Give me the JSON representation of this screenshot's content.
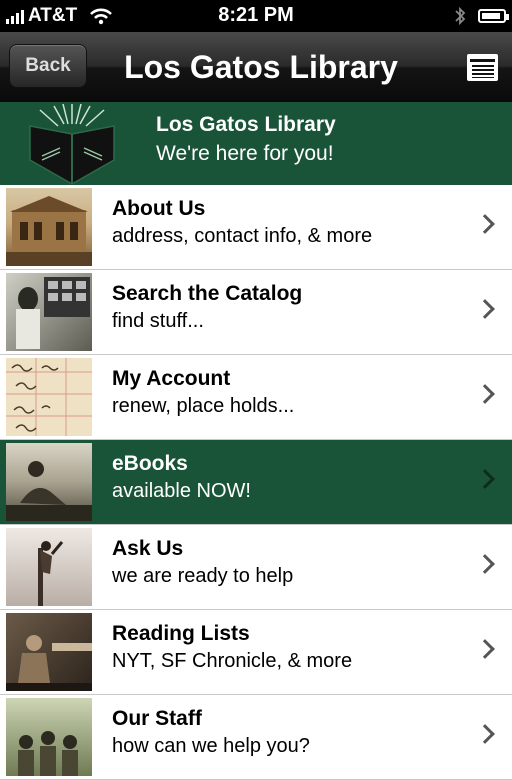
{
  "status_bar": {
    "carrier": "AT&T",
    "time": "8:21 PM"
  },
  "navbar": {
    "back_label": "Back",
    "title": "Los Gatos Library"
  },
  "banner": {
    "title": "Los Gatos Library",
    "subtitle": "We're here for you!"
  },
  "menu": [
    {
      "title": "About Us",
      "subtitle": "address, contact info, & more"
    },
    {
      "title": "Search the Catalog",
      "subtitle": "find stuff..."
    },
    {
      "title": "My Account",
      "subtitle": "renew, place holds..."
    },
    {
      "title": "eBooks",
      "subtitle": "available NOW!"
    },
    {
      "title": "Ask Us",
      "subtitle": "we are ready to help"
    },
    {
      "title": "Reading Lists",
      "subtitle": "NYT, SF Chronicle, & more"
    },
    {
      "title": "Our Staff",
      "subtitle": "how can we help you?"
    }
  ],
  "colors": {
    "accent_green": "#1a5438",
    "navbar_dark": "#1c1c1c"
  }
}
